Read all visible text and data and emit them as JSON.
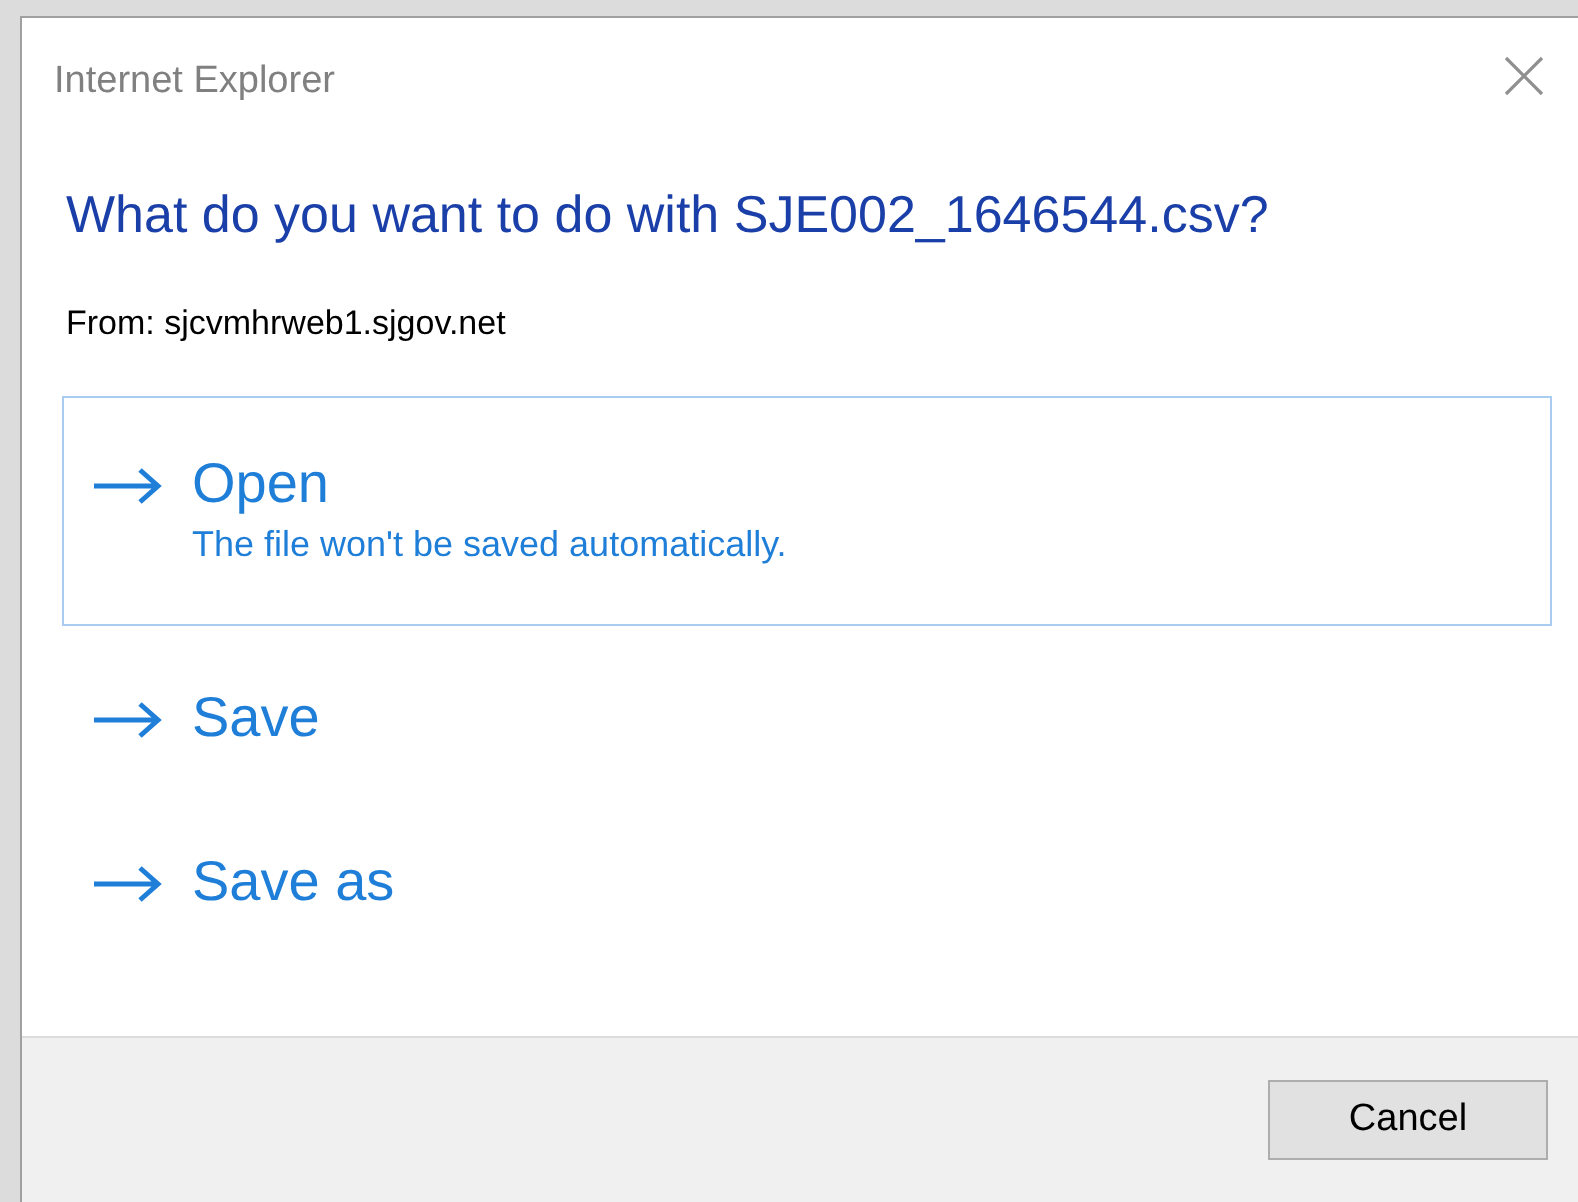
{
  "window": {
    "title": "Internet Explorer"
  },
  "heading": "What do you want to do with SJE002_1646544.csv?",
  "source": "From: sjcvmhrweb1.sjgov.net",
  "options": [
    {
      "label": "Open",
      "description": "The file won't be saved automatically.",
      "selected": true
    },
    {
      "label": "Save",
      "selected": false
    },
    {
      "label": "Save as",
      "selected": false
    }
  ],
  "buttons": [
    "Cancel"
  ]
}
